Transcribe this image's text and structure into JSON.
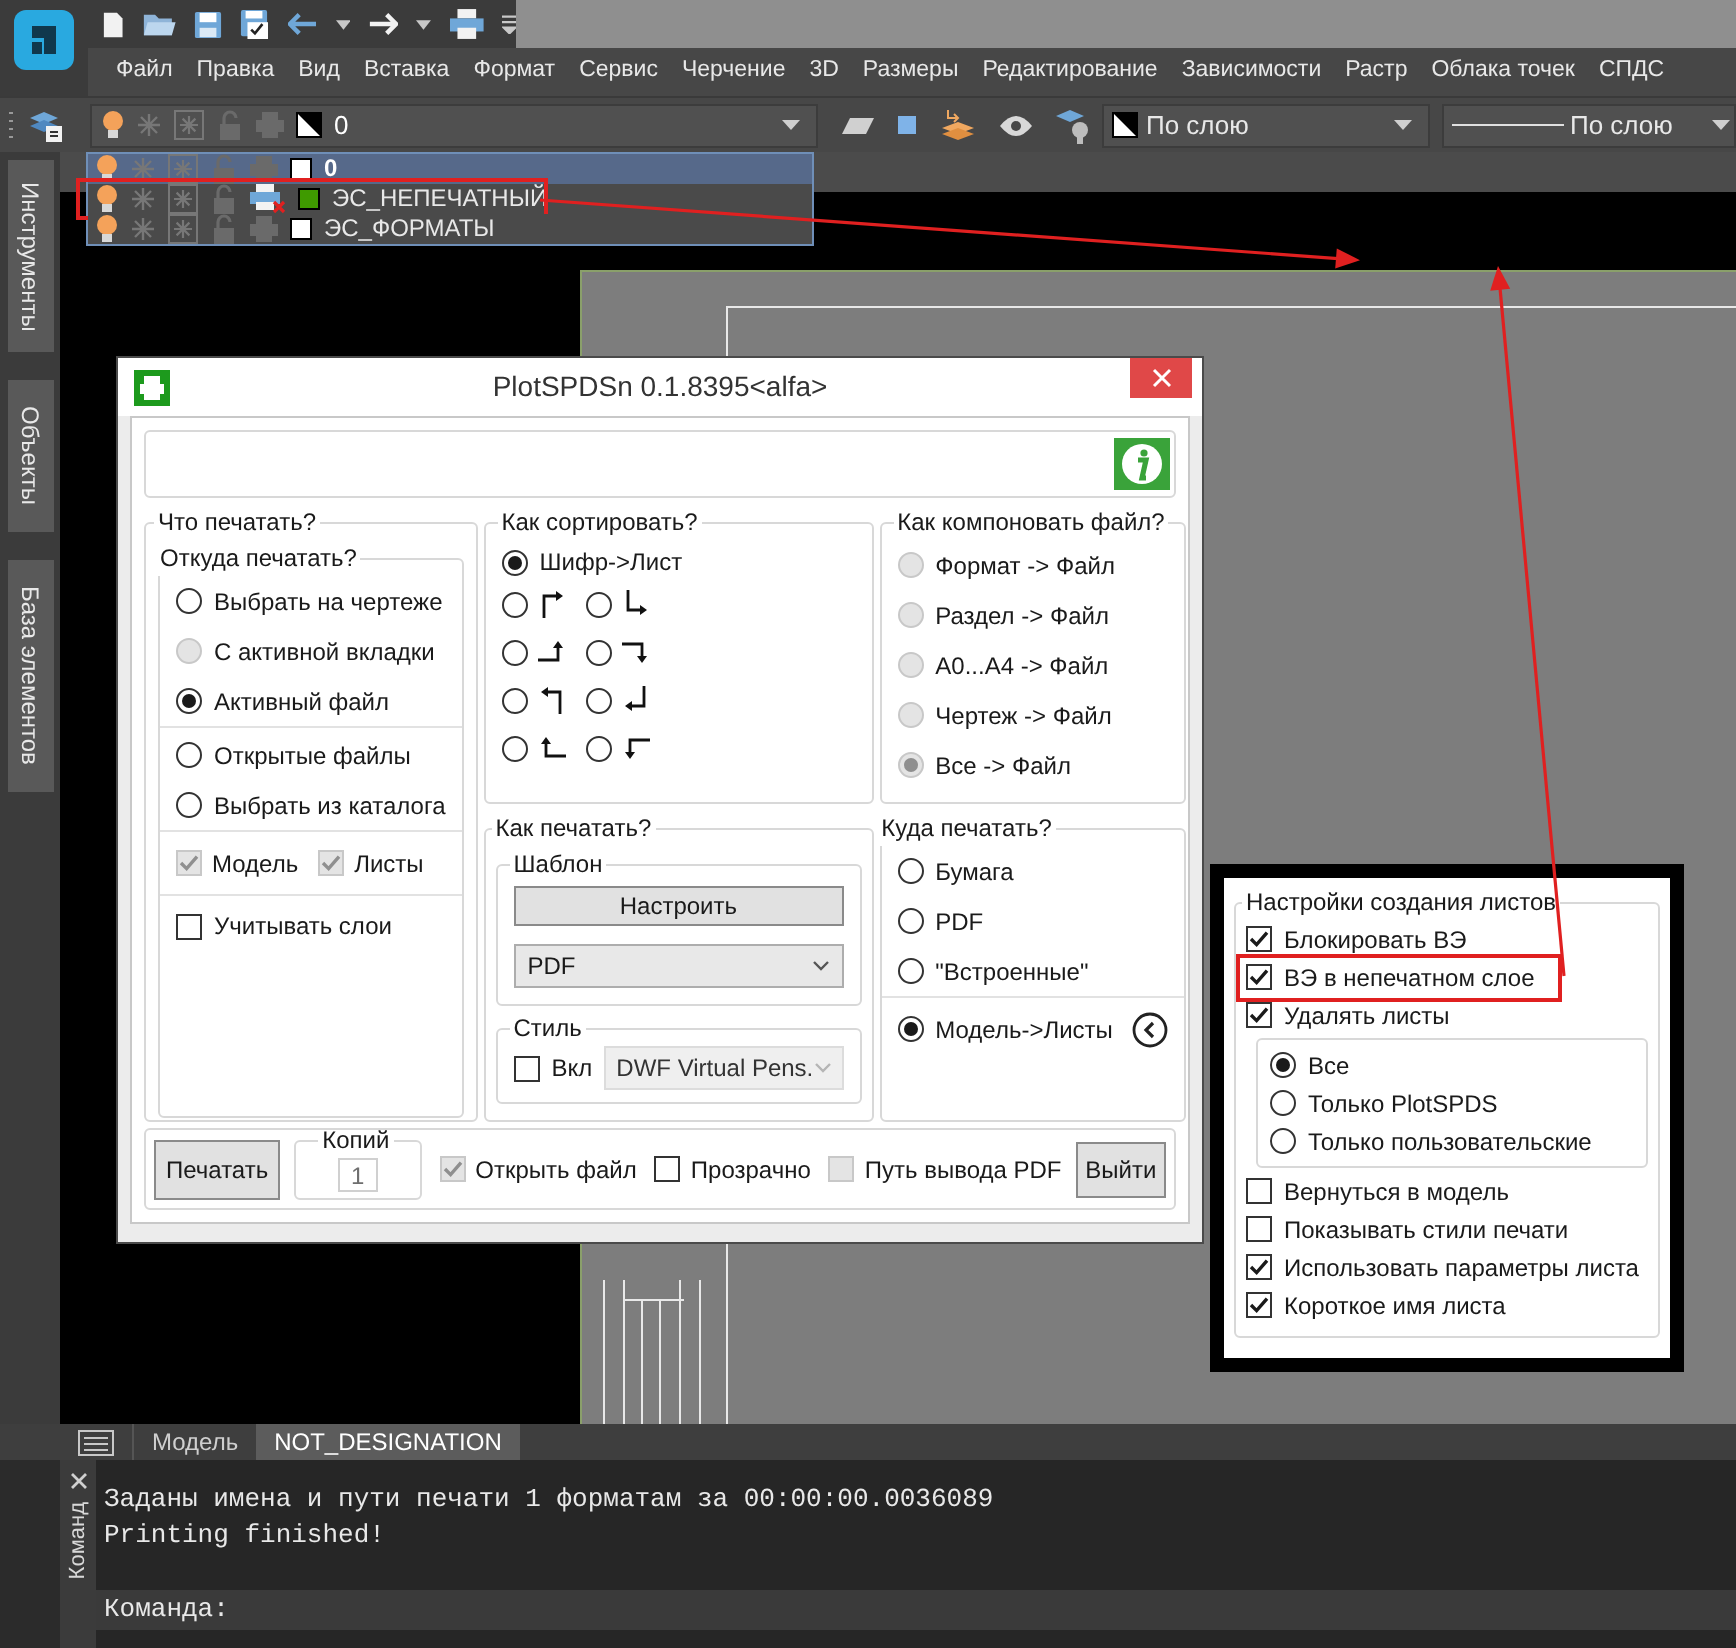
{
  "menu": [
    "Файл",
    "Правка",
    "Вид",
    "Вставка",
    "Формат",
    "Сервис",
    "Черчение",
    "3D",
    "Размеры",
    "Редактирование",
    "Зависимости",
    "Растр",
    "Облака точек",
    "СПДС"
  ],
  "layer_combo": {
    "value": "0"
  },
  "layers": [
    {
      "name": "0",
      "selected": true,
      "plottable": true,
      "color": "#ffffff",
      "highlighted": false
    },
    {
      "name": "ЭС_НЕПЕЧАТНЫЙ",
      "selected": false,
      "plottable": false,
      "color": "#3f9a00",
      "highlighted": true
    },
    {
      "name": "ЭС_ФОРМАТЫ",
      "selected": false,
      "plottable": true,
      "color": "#ffffff",
      "highlighted": false
    }
  ],
  "color_combo": {
    "value": "По слою"
  },
  "linetype_combo": {
    "value": "По слою"
  },
  "side_tabs": [
    "Инструменты",
    "Объекты",
    "База элементов"
  ],
  "layout_tabs": [
    {
      "label": "Модель",
      "selected": false
    },
    {
      "label": "NOT_DESIGNATION",
      "selected": true
    }
  ],
  "command": {
    "panel_label": "Команд",
    "lines": [
      "Заданы имена и пути печати 1 форматам за 00:00:00.0036089",
      "Printing finished!"
    ],
    "prompt": "Команда:"
  },
  "dialog": {
    "title": "PlotSPDSn 0.1.8395<alfa>",
    "what_to_print": {
      "title": "Что печатать?",
      "source": {
        "title": "Откуда печатать?",
        "groups": [
          [
            {
              "label": "Выбрать на чертеже",
              "selected": false,
              "disabled": false
            },
            {
              "label": "С активной вкладки",
              "selected": false,
              "disabled": true
            },
            {
              "label": "Активный файл",
              "selected": true,
              "disabled": false
            }
          ],
          [
            {
              "label": "Открытые файлы",
              "selected": false,
              "disabled": false
            },
            {
              "label": "Выбрать из каталога",
              "selected": false,
              "disabled": false
            }
          ]
        ]
      },
      "space": [
        {
          "label": "Модель",
          "checked": true,
          "disabled": true
        },
        {
          "label": "Листы",
          "checked": true,
          "disabled": true
        }
      ],
      "layers_option": {
        "label": "Учитывать слои",
        "checked": false,
        "disabled": false
      }
    },
    "sort": {
      "title": "Как сортировать?",
      "primary": {
        "label": "Шифр->Лист",
        "selected": true
      },
      "arrows": [
        {
          "kind": "upright",
          "selected": false
        },
        {
          "kind": "downright",
          "selected": false
        },
        {
          "kind": "rightup",
          "selected": false
        },
        {
          "kind": "rightdown",
          "selected": false
        },
        {
          "kind": "upleft",
          "selected": false
        },
        {
          "kind": "downleft",
          "selected": false
        },
        {
          "kind": "leftup",
          "selected": false
        },
        {
          "kind": "leftdown",
          "selected": false
        }
      ]
    },
    "compose": {
      "title": "Как компоновать файл?",
      "options": [
        {
          "label": "Формат -> Файл",
          "selected": false,
          "disabled": true
        },
        {
          "label": "Раздел -> Файл",
          "selected": false,
          "disabled": true
        },
        {
          "label": "A0...A4 -> Файл",
          "selected": false,
          "disabled": true
        },
        {
          "label": "Чертеж -> Файл",
          "selected": false,
          "disabled": true
        },
        {
          "label": "Все -> Файл",
          "selected": true,
          "disabled": true
        }
      ]
    },
    "how_to_print": {
      "title": "Как печатать?",
      "template": {
        "title": "Шаблон",
        "button": "Настроить",
        "select": "PDF"
      },
      "style": {
        "title": "Стиль",
        "enable": {
          "label": "Вкл",
          "checked": false,
          "disabled": false
        },
        "select": {
          "value": "DWF Virtual Pens.",
          "disabled": true
        }
      }
    },
    "destination": {
      "title": "Куда печатать?",
      "groups": [
        [
          {
            "label": "Бумага",
            "selected": false
          },
          {
            "label": "PDF",
            "selected": false
          },
          {
            "label": "\"Встроенные\"",
            "selected": false
          }
        ],
        [
          {
            "label": "Модель->Листы",
            "selected": true
          }
        ]
      ]
    },
    "footer": {
      "print_button": "Печатать",
      "copies": {
        "title": "Копий",
        "value": "1",
        "disabled": true
      },
      "options": [
        {
          "label": "Открыть файл",
          "checked": true,
          "disabled": true
        },
        {
          "label": "Прозрачно",
          "checked": false,
          "disabled": false
        },
        {
          "label": "Путь вывода PDF",
          "checked": false,
          "disabled": true
        }
      ],
      "exit_button": "Выйти"
    }
  },
  "settings_panel": {
    "title": "Настройки создания листов",
    "items": [
      {
        "kind": "checkbox",
        "label": "Блокировать ВЭ",
        "checked": true,
        "highlighted": false
      },
      {
        "kind": "checkbox",
        "label": "ВЭ в непечатном слое",
        "checked": true,
        "highlighted": true
      },
      {
        "kind": "checkbox",
        "label": "Удалять листы",
        "checked": true,
        "highlighted": false
      },
      {
        "kind": "radio_group",
        "highlighted": false,
        "options": [
          {
            "label": "Все",
            "selected": true
          },
          {
            "label": "Только PlotSPDS",
            "selected": false
          },
          {
            "label": "Только пользовательские",
            "selected": false
          }
        ]
      },
      {
        "kind": "checkbox",
        "label": "Вернуться в модель",
        "checked": false,
        "highlighted": false
      },
      {
        "kind": "checkbox",
        "label": "Показывать стили печати",
        "checked": false,
        "highlighted": false
      },
      {
        "kind": "checkbox",
        "label": "Использовать параметры листа",
        "checked": true,
        "highlighted": false
      },
      {
        "kind": "checkbox",
        "label": "Короткое имя листа",
        "checked": true,
        "highlighted": false
      }
    ]
  }
}
